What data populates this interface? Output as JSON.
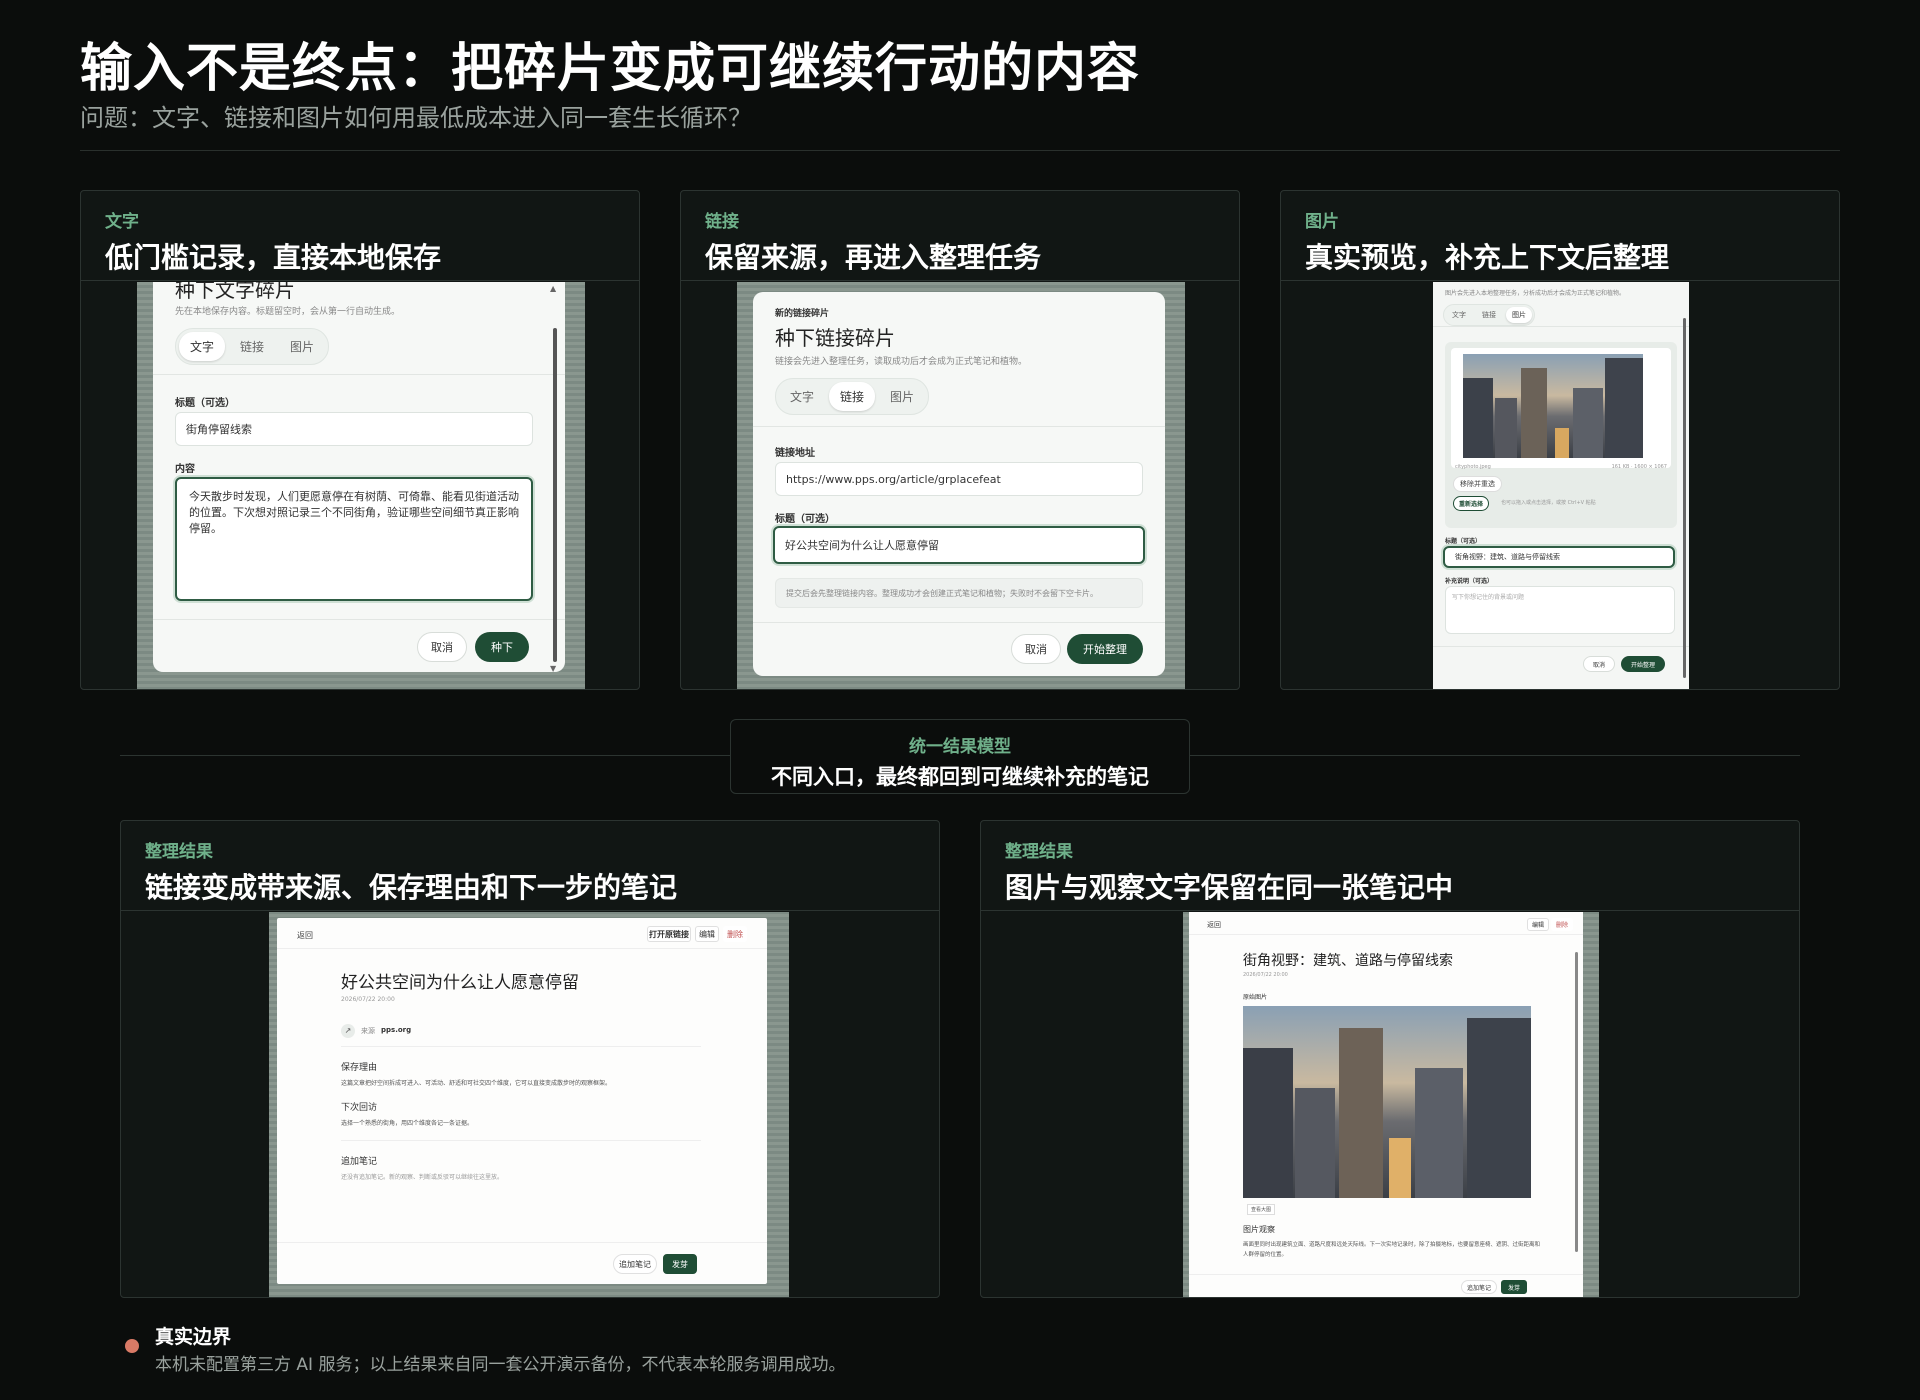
{
  "header": {
    "title": "输入不是终点：把碎片变成可继续行动的内容",
    "subtitle": "问题：文字、链接和图片如何用最低成本进入同一套生长循环？"
  },
  "cards": {
    "text": {
      "kicker": "文字",
      "title": "低门槛记录，直接本地保存",
      "modal": {
        "heading": "种下文字碎片",
        "hint": "先在本地保存内容。标题留空时，会从第一行自动生成。",
        "tabs": [
          "文字",
          "链接",
          "图片"
        ],
        "title_label": "标题（可选）",
        "title_value": "街角停留线索",
        "content_label": "内容",
        "content_value": "今天散步时发现，人们更愿意停在有树荫、可倚靠、能看见街道活动的位置。下次想对照记录三个不同街角，验证哪些空间细节真正影响停留。",
        "cancel": "取消",
        "submit": "种下"
      }
    },
    "link": {
      "kicker": "链接",
      "title": "保留来源，再进入整理任务",
      "modal": {
        "eyebrow": "新的链接碎片",
        "heading": "种下链接碎片",
        "hint": "链接会先进入整理任务，读取成功后才会成为正式笔记和植物。",
        "tabs": [
          "文字",
          "链接",
          "图片"
        ],
        "url_label": "链接地址",
        "url_value": "https://www.pps.org/article/grplacefeat",
        "title_label": "标题（可选）",
        "title_value": "好公共空间为什么让人愿意停留",
        "notice": "提交后会先整理链接内容。整理成功才会创建正式笔记和植物；失败时不会留下空卡片。",
        "cancel": "取消",
        "submit": "开始整理"
      }
    },
    "image": {
      "kicker": "图片",
      "title": "真实预览，补充上下文后整理",
      "modal": {
        "hint": "图片会先进入本地整理任务，分析成功后才会成为正式笔记和植物。",
        "tabs": [
          "文字",
          "链接",
          "图片"
        ],
        "file_name": "cityphoto.jpeg",
        "file_meta": "161 KB · 1600 × 1067",
        "remove": "移除并重选",
        "reselect": "重新选择",
        "paste_hint": "也可以拖入或点击选择，或按 Ctrl+V 粘贴",
        "title_label": "标题（可选）",
        "title_value": "街角视野：建筑、道路与停留线索",
        "desc_label": "补充说明（可选）",
        "desc_placeholder": "写下你想记住的背景或问题",
        "cancel": "取消",
        "submit": "开始整理"
      }
    }
  },
  "unified": {
    "kicker": "统一结果模型",
    "text": "不同入口，最终都回到可继续补充的笔记"
  },
  "results": {
    "link": {
      "kicker": "整理结果",
      "title": "链接变成带来源、保存理由和下一步的笔记",
      "page": {
        "back": "返回",
        "open": "打开原链接",
        "edit": "编辑",
        "delete": "删除",
        "heading": "好公共空间为什么让人愿意停留",
        "date": "2026/07/22 20:00",
        "source_label": "来源",
        "source": "pps.org",
        "reason_title": "保存理由",
        "reason": "这篇文章把好空间拆成可进入、可活动、舒适和可社交四个维度，它可以直接变成散步时的观察框架。",
        "next_title": "下次回访",
        "next": "选择一个熟悉的街角，用四个维度各记一条证据。",
        "add_title": "追加笔记",
        "add_hint": "还没有追加笔记。新的观察、判断或反驳可以继续往这里放。",
        "add_btn": "追加笔记",
        "water_btn": "发芽"
      }
    },
    "image": {
      "kicker": "整理结果",
      "title": "图片与观察文字保留在同一张笔记中",
      "page": {
        "back": "返回",
        "edit": "编辑",
        "delete": "删除",
        "heading": "街角视野：建筑、道路与停留线索",
        "date": "2026/07/22 20:00",
        "orig_label": "原始图片",
        "caption": "查看大图",
        "obs_title": "图片观察",
        "obs": "画面里同时出现建筑立面、道路尺度和远处天际线。下一次实地记录时，除了拍摄地标，也要留意座椅、遮阴、过街距离和人群停留的位置。",
        "add_btn": "追加笔记",
        "water_btn": "发芽"
      }
    }
  },
  "footer": {
    "title": "真实边界",
    "text": "本机未配置第三方 AI 服务；以上结果来自同一套公开演示备份，不代表本轮服务调用成功。"
  },
  "colors": {
    "background": "#0b0d0c",
    "accent_green": "#6fb08a",
    "primary_button": "#1f4d35",
    "footer_dot": "#d97a66"
  }
}
